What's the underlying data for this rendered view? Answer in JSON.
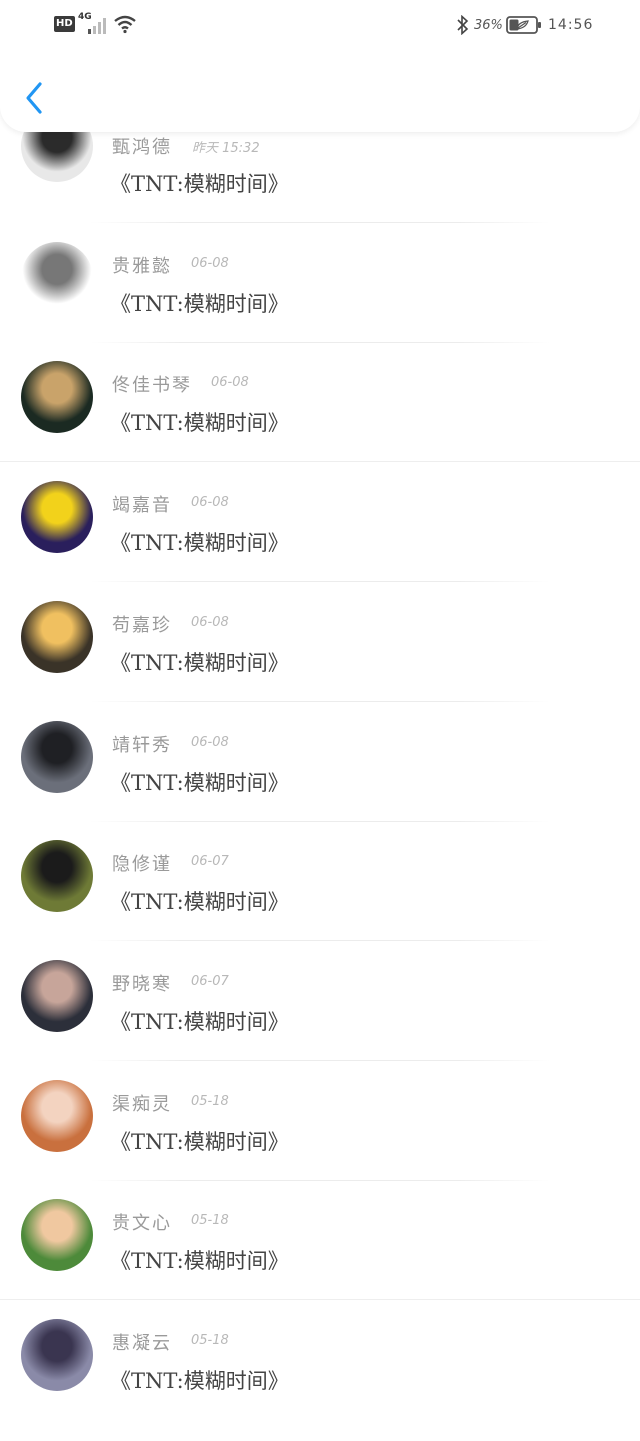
{
  "status_bar": {
    "hd_label": "HD",
    "network_label": "4G",
    "battery_percent": "36%",
    "battery_level": 0.36,
    "time": "14:56"
  },
  "header": {
    "back_icon": "chevron-left-icon",
    "accent_color": "#2196f3"
  },
  "messages": [
    {
      "name": "甄鸿德",
      "date": "昨天 15:32",
      "text": "《TNT:模糊时间》",
      "avatar_colors": [
        "#e8e8e8",
        "#2b2b2b"
      ]
    },
    {
      "name": "贵雅懿",
      "date": "06-08",
      "text": "《TNT:模糊时间》",
      "avatar_colors": [
        "#ffffff",
        "#777777"
      ]
    },
    {
      "name": "佟佳书琴",
      "date": "06-08",
      "text": "《TNT:模糊时间》",
      "avatar_colors": [
        "#1b2a22",
        "#c9a36a"
      ]
    },
    {
      "name": "竭嘉音",
      "date": "06-08",
      "text": "《TNT:模糊时间》",
      "avatar_colors": [
        "#2a1f5c",
        "#f2d21b"
      ]
    },
    {
      "name": "苟嘉珍",
      "date": "06-08",
      "text": "《TNT:模糊时间》",
      "avatar_colors": [
        "#3a3328",
        "#f0c060"
      ]
    },
    {
      "name": "靖轩秀",
      "date": "06-08",
      "text": "《TNT:模糊时间》",
      "avatar_colors": [
        "#6b6f7a",
        "#1f2024"
      ]
    },
    {
      "name": "隐修谨",
      "date": "06-07",
      "text": "《TNT:模糊时间》",
      "avatar_colors": [
        "#6e7a36",
        "#1b1b1b"
      ]
    },
    {
      "name": "野晓寒",
      "date": "06-07",
      "text": "《TNT:模糊时间》",
      "avatar_colors": [
        "#2c2f3a",
        "#c7a59a"
      ]
    },
    {
      "name": "渠痴灵",
      "date": "05-18",
      "text": "《TNT:模糊时间》",
      "avatar_colors": [
        "#c9703e",
        "#f3d3c0"
      ]
    },
    {
      "name": "贵文心",
      "date": "05-18",
      "text": "《TNT:模糊时间》",
      "avatar_colors": [
        "#4d8a3a",
        "#f0c8a0"
      ]
    },
    {
      "name": "惠凝云",
      "date": "05-18",
      "text": "《TNT:模糊时间》",
      "avatar_colors": [
        "#8a8aa8",
        "#3a3550"
      ]
    }
  ]
}
